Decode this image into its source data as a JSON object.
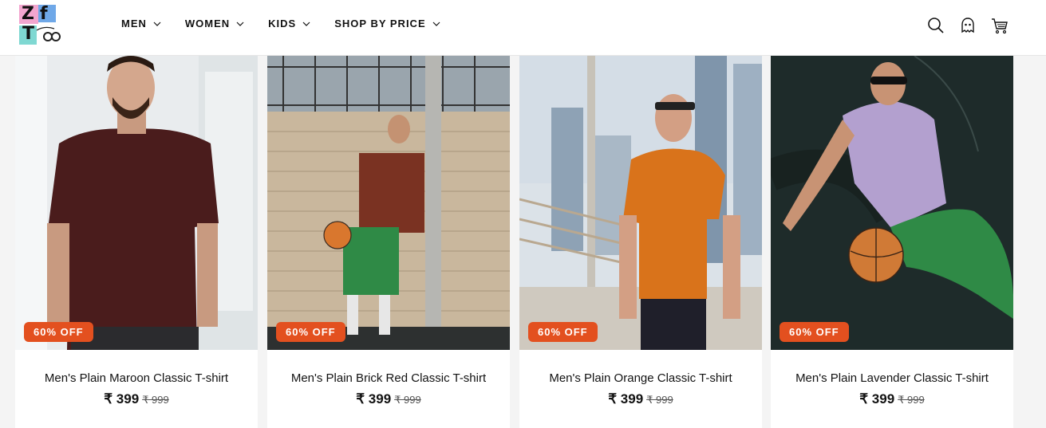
{
  "brand": {
    "logo_text": [
      "Z",
      "f",
      "T"
    ],
    "logo_script": "Zenfrater"
  },
  "nav": [
    {
      "label": "MEN"
    },
    {
      "label": "WOMEN"
    },
    {
      "label": "KIDS"
    },
    {
      "label": "SHOP BY PRICE"
    }
  ],
  "header_icons": [
    "search-icon",
    "account-icon",
    "cart-icon"
  ],
  "products": [
    {
      "title": "Men's Plain Maroon Classic T-shirt",
      "badge": "60% OFF",
      "price": "₹ 399",
      "compare_price": "₹ 999",
      "shirt_color": "#4a1c1c"
    },
    {
      "title": "Men's Plain Brick Red Classic T-shirt",
      "badge": "60% OFF",
      "price": "₹ 399",
      "compare_price": "₹ 999",
      "shirt_color": "#7a3222"
    },
    {
      "title": "Men's Plain Orange Classic T-shirt",
      "badge": "60% OFF",
      "price": "₹ 399",
      "compare_price": "₹ 999",
      "shirt_color": "#d9731b"
    },
    {
      "title": "Men's Plain Lavender Classic T-shirt",
      "badge": "60% OFF",
      "price": "₹ 399",
      "compare_price": "₹ 999",
      "shirt_color": "#b3a0cf"
    }
  ],
  "colors": {
    "badge": "#e3501f",
    "text": "#121212"
  }
}
